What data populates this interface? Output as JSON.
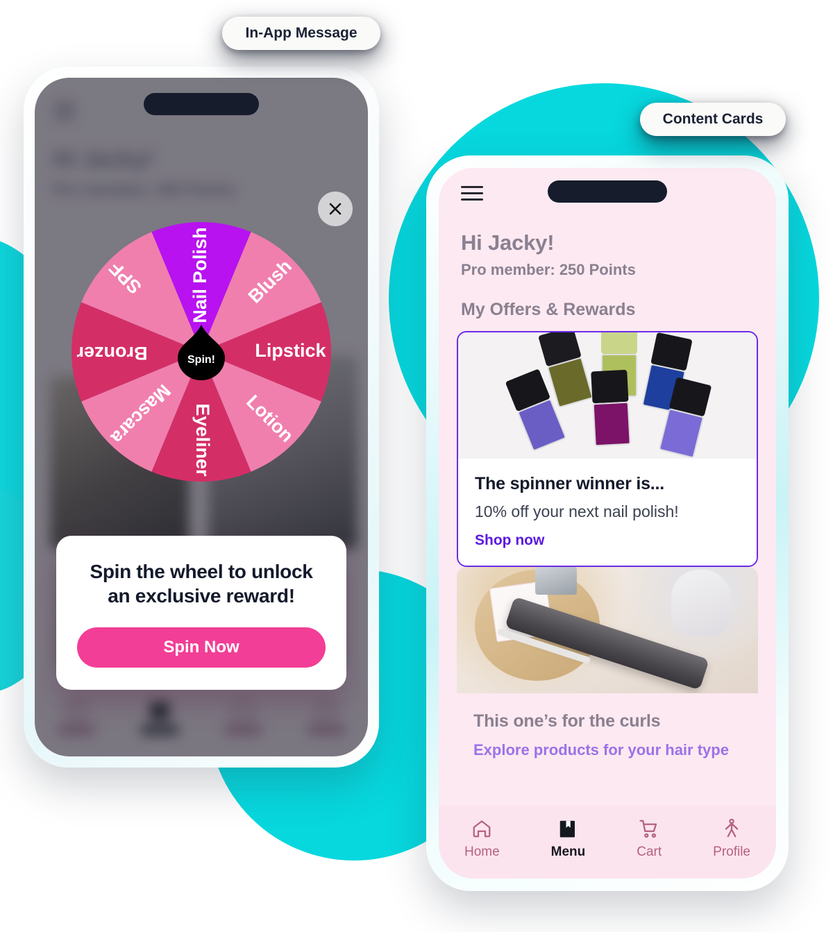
{
  "labels": {
    "in_app_message": "In-App Message",
    "content_cards": "Content Cards"
  },
  "colors": {
    "cyan_blob": "#07D8DE",
    "wheel_purple": "#B812F0",
    "wheel_pink_light": "#F07FAE",
    "wheel_pink_dark": "#D42E67",
    "spin_button": "#F23E96",
    "card_border_purple": "#6B2BE8",
    "link_purple": "#5B1AE0",
    "link_lavender": "#9C72E8",
    "phone2_bg": "#FDE9F1",
    "notch": "#161C2B"
  },
  "phone1": {
    "background_app": {
      "greeting": "Hi Jacky!",
      "subtitle": "Pro member: 250 Points",
      "nav_items": [
        "Home",
        "Menu",
        "Cart",
        "Profile"
      ],
      "active_nav": "Menu"
    },
    "close_button_label": "Close",
    "wheel": {
      "center_label": "Spin!",
      "segments": [
        {
          "label": "Nail Polish",
          "color": "#B812F0",
          "winner": true
        },
        {
          "label": "Blush",
          "color": "#F07FAE",
          "winner": false
        },
        {
          "label": "Lipstick",
          "color": "#D42E67",
          "winner": false
        },
        {
          "label": "Lotion",
          "color": "#F07FAE",
          "winner": false
        },
        {
          "label": "Eyeliner",
          "color": "#D42E67",
          "winner": false
        },
        {
          "label": "Mascara",
          "color": "#F07FAE",
          "winner": false
        },
        {
          "label": "Bronzer",
          "color": "#D42E67",
          "winner": false
        },
        {
          "label": "SPF",
          "color": "#F07FAE",
          "winner": false
        }
      ]
    },
    "card": {
      "title_line1": "Spin the wheel to unlock",
      "title_line2": "an exclusive reward!",
      "button_label": "Spin Now"
    }
  },
  "phone2": {
    "greeting": "Hi Jacky!",
    "subtitle": "Pro member: 250 Points",
    "section_title": "My Offers & Rewards",
    "cards": [
      {
        "title": "The spinner winner is...",
        "description": "10% off your next nail polish!",
        "link": "Shop now",
        "image_alt": "nail-polish-bottles",
        "style": "bordered"
      },
      {
        "title": "This one’s for the curls",
        "description": "",
        "link": "Explore products for your hair type",
        "image_alt": "hair-straightener-flat-iron",
        "style": "plain"
      }
    ],
    "nav": [
      {
        "label": "Home",
        "icon": "home-icon",
        "active": false
      },
      {
        "label": "Menu",
        "icon": "book-icon",
        "active": true
      },
      {
        "label": "Cart",
        "icon": "cart-icon",
        "active": false
      },
      {
        "label": "Profile",
        "icon": "person-icon",
        "active": false
      }
    ]
  }
}
